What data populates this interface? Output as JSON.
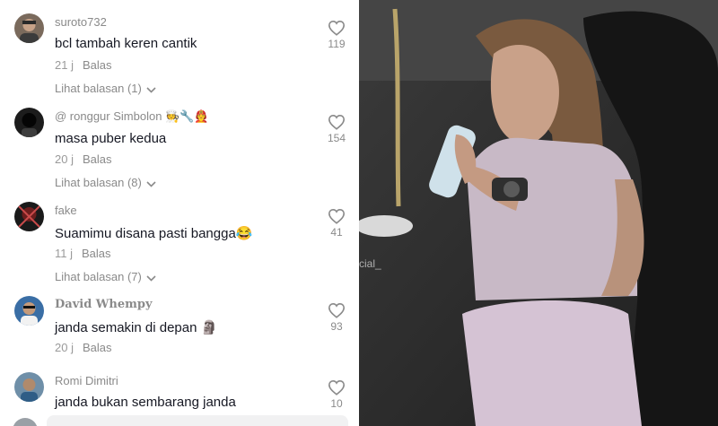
{
  "comments": [
    {
      "username": "suroto732",
      "text": "bcl tambah keren cantik",
      "time": "21 j",
      "reply_label": "Balas",
      "view_replies": "Lihat balasan (1)",
      "likes": "119"
    },
    {
      "username": "@ ronggur Simbolon 🧑‍🍳🔧🧑‍🚒",
      "text": "masa puber kedua",
      "time": "20 j",
      "reply_label": "Balas",
      "view_replies": "Lihat balasan (8)",
      "likes": "154"
    },
    {
      "username": "fake",
      "text": "Suamimu disana pasti bangga😂",
      "time": "11 j",
      "reply_label": "Balas",
      "view_replies": "Lihat balasan (7)",
      "likes": "41"
    },
    {
      "username": "David Whempy",
      "text": "janda semakin di depan 🗿",
      "time": "20 j",
      "reply_label": "Balas",
      "likes": "93"
    },
    {
      "username": "Romi Dimitri",
      "text": "janda bukan sembarang janda",
      "likes": "10"
    }
  ],
  "photo": {
    "watermark_text": "cial_"
  },
  "icons": {
    "like": "heart-outline-icon",
    "expand": "chevron-down-icon"
  },
  "colors": {
    "primary_text": "#161823",
    "secondary_text": "#8a8a8a",
    "background": "#ffffff"
  }
}
